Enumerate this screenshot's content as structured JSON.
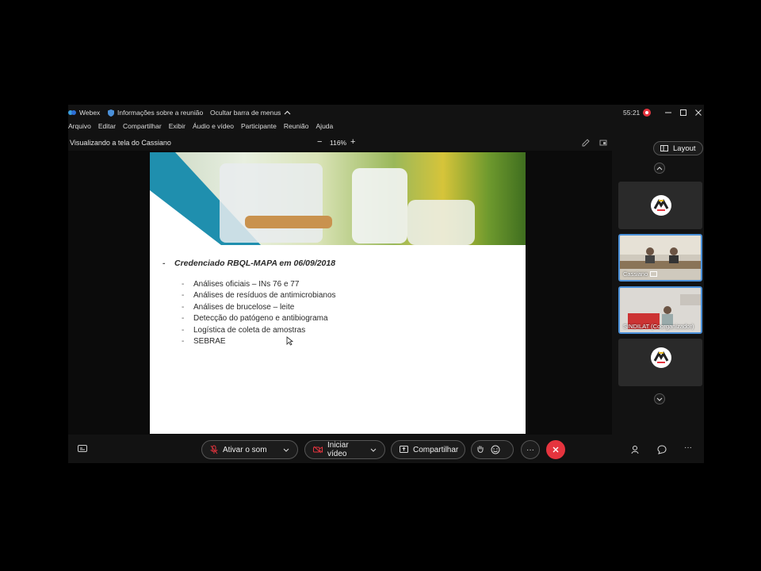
{
  "titlebar": {
    "app_name": "Webex",
    "meeting_info": "Informações sobre a reunião",
    "hide_menu": "Ocultar barra de menus",
    "timer": "55:21"
  },
  "menu": [
    "Arquivo",
    "Editar",
    "Compartilhar",
    "Exibir",
    "Áudio e vídeo",
    "Participante",
    "Reunião",
    "Ajuda"
  ],
  "share": {
    "viewing_label": "Visualizando a tela do Cassiano",
    "zoom": "116%",
    "zoom_out": "−",
    "zoom_in": "+"
  },
  "slide": {
    "main_bullet": "Credenciado RBQL-MAPA em 06/09/2018",
    "sub_bullets": [
      "Análises oficiais – INs 76 e 77",
      "Análises de resíduos de antimicrobianos",
      "Análises de brucelose – leite",
      "Detecção do patógeno e antibiograma",
      "Logística de coleta de amostras",
      "SEBRAE"
    ]
  },
  "panel": {
    "layout_label": "Layout",
    "participants": [
      {
        "name": ""
      },
      {
        "name": "Cassiano"
      },
      {
        "name": "SINDILAT (Coorganizador)"
      },
      {
        "name": ""
      }
    ]
  },
  "controls": {
    "mute_label": "Ativar o som",
    "video_label": "Iniciar vídeo",
    "share_label": "Compartilhar",
    "more_label": "···"
  },
  "colors": {
    "accent_blue": "#4a90d9",
    "end_red": "#e5343e",
    "slide_teal": "#1f8fae"
  }
}
